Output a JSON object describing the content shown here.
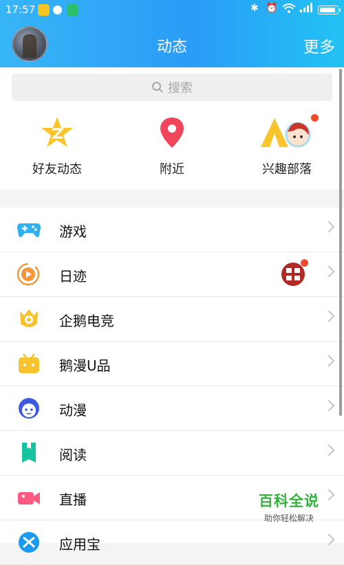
{
  "status_bar": {
    "time": "17:57"
  },
  "header": {
    "title": "动态",
    "more_label": "更多"
  },
  "search": {
    "placeholder": "搜索"
  },
  "quick_actions": [
    {
      "label": "好友动态",
      "icon": "qzone-star-icon"
    },
    {
      "label": "附近",
      "icon": "location-pin-icon"
    },
    {
      "label": "兴趣部落",
      "icon": "tribe-tent-icon"
    }
  ],
  "menu_items": [
    {
      "label": "游戏",
      "icon": "gamepad-icon"
    },
    {
      "label": "日迹",
      "icon": "play-circle-icon"
    },
    {
      "label": "企鹅电竞",
      "icon": "esports-crown-icon"
    },
    {
      "label": "鹅漫U品",
      "icon": "tv-box-icon"
    },
    {
      "label": "动漫",
      "icon": "anime-face-icon"
    },
    {
      "label": "阅读",
      "icon": "book-icon"
    },
    {
      "label": "直播",
      "icon": "video-camera-icon"
    },
    {
      "label": "应用宝",
      "icon": "app-store-icon"
    }
  ],
  "watermark": {
    "title": "百科全说",
    "subtitle": "助你轻松解决"
  },
  "colors": {
    "header_start": "#37b6f7",
    "header_end": "#22c2f3",
    "badge_red": "#f14a2b"
  }
}
